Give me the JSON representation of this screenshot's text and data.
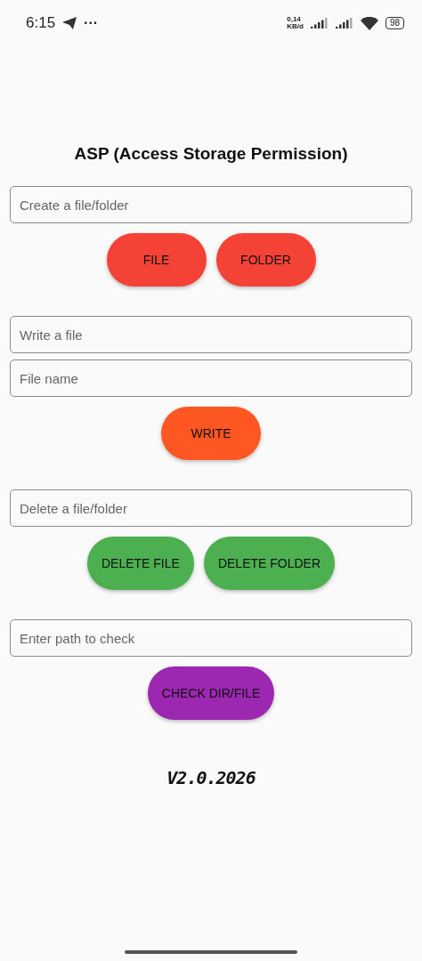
{
  "status_bar": {
    "time": "6:15",
    "more": "···",
    "net_speed": [
      "0,14",
      "KB/d"
    ],
    "battery": "98"
  },
  "title": "ASP (Access Storage Permission)",
  "sections": [
    {
      "fields": [
        {
          "placeholder": "Create a file/folder"
        }
      ],
      "buttons": [
        {
          "label": "FILE",
          "color": "#f44336"
        },
        {
          "label": "FOLDER",
          "color": "#f44336"
        }
      ]
    },
    {
      "fields": [
        {
          "placeholder": "Write a file"
        },
        {
          "placeholder": "File name"
        }
      ],
      "buttons": [
        {
          "label": "WRITE",
          "color": "#ff5722"
        }
      ]
    },
    {
      "fields": [
        {
          "placeholder": "Delete a file/folder"
        }
      ],
      "buttons": [
        {
          "label": "DELETE FILE",
          "color": "#4caf50"
        },
        {
          "label": "DELETE FOLDER",
          "color": "#4caf50"
        }
      ]
    },
    {
      "fields": [
        {
          "placeholder": "Enter path to check"
        }
      ],
      "buttons": [
        {
          "label": "CHECK DIR/FILE",
          "color": "#9c27b0"
        }
      ]
    }
  ],
  "version": "V2.0.2026"
}
